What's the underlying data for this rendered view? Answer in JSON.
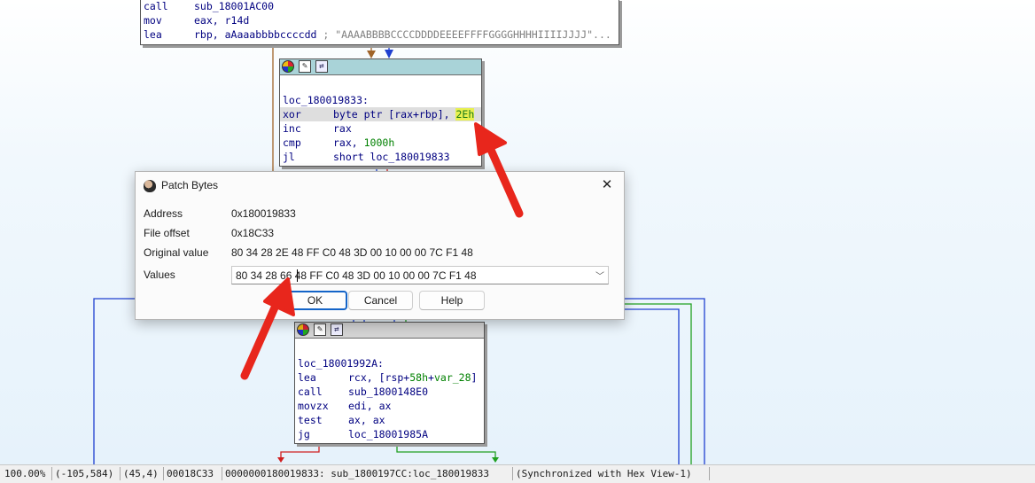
{
  "top_block": {
    "rows": [
      {
        "mnemonic": "call",
        "operand": "sub_18001AC00"
      },
      {
        "mnemonic": "mov",
        "operand": "eax, r14d"
      },
      {
        "mnemonic": "lea",
        "operand": "rbp, aAaaabbbbccccdd",
        "comment": " ; \"AAAABBBBCCCCDDDDEEEEFFFFGGGGHHHHIIIIJJJJ\"..."
      }
    ]
  },
  "loop_block": {
    "label": "loc_180019833:",
    "rows": [
      {
        "mnemonic": "xor",
        "operand": "byte ptr [rax+rbp], ",
        "number": "2Eh"
      },
      {
        "mnemonic": "inc",
        "operand": "rax"
      },
      {
        "mnemonic": "cmp",
        "operand": "rax, ",
        "number": "1000h"
      },
      {
        "mnemonic": "jl",
        "operand": "short loc_180019833"
      }
    ]
  },
  "lower_block": {
    "label": "loc_18001992A:",
    "rows": [
      {
        "mnemonic": "lea",
        "pre": "rcx, [rsp+",
        "num": "58h",
        "mid": "+",
        "var": "var_28",
        "post": "]"
      },
      {
        "mnemonic": "call",
        "operand": "sub_1800148E0"
      },
      {
        "mnemonic": "movzx",
        "operand": "edi, ax"
      },
      {
        "mnemonic": "test",
        "operand": "ax, ax"
      },
      {
        "mnemonic": "jg",
        "operand": "loc_18001985A"
      }
    ]
  },
  "dialog": {
    "title": "Patch Bytes",
    "close": "✕",
    "fields": {
      "address_label": "Address",
      "address_value": "0x180019833",
      "offset_label": "File offset",
      "offset_value": "0x18C33",
      "original_label": "Original value",
      "original_value": "80 34 28 2E 48 FF C0 48 3D 00 10 00 00 7C F1 48",
      "values_label": "Values",
      "values_value": "80 34 28 66 48 FF C0 48 3D 00 10 00 00 7C F1 48"
    },
    "buttons": {
      "ok": "OK",
      "cancel": "Cancel",
      "help": "Help"
    }
  },
  "icons": {
    "block_header": [
      "color-icon",
      "edit-icon",
      "graph-icon"
    ],
    "dialog": "ida-icon",
    "dropdown": "chevron-down-icon"
  },
  "statusbar": {
    "zoom": "100.00%",
    "graph_pos": "(-105,584)",
    "cursor": "(45,4)",
    "offset": "00018C33",
    "location": "0000000180019833: sub_1800197CC:loc_180019833",
    "sync": "(Synchronized with Hex View-1)"
  },
  "colors": {
    "header_teal": "#a9d3d8",
    "mnemonic_blue": "#000080",
    "immediate_green": "#008000",
    "highlight_yellow": "#e8f050",
    "annotation_red": "#e8261c",
    "edge_blue": "#2040d0",
    "edge_green": "#20a020",
    "edge_red": "#d02020",
    "edge_orange": "#a0642a"
  }
}
